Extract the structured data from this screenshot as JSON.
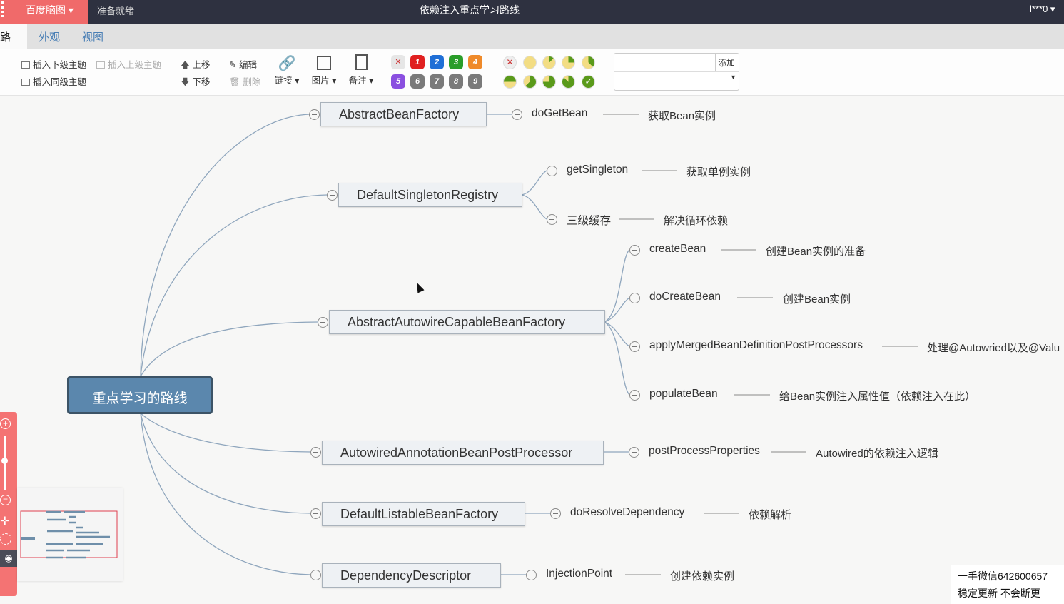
{
  "titlebar": {
    "brand": "百度脑图",
    "status": "准备就绪",
    "title": "依赖注入重点学习路线",
    "user": "l***0"
  },
  "tabs": [
    {
      "label": "思路"
    },
    {
      "label": "外观"
    },
    {
      "label": "视图"
    }
  ],
  "toolbar": {
    "insert_child": "插入下级主题",
    "insert_parent": "插入上级主题",
    "insert_sibling": "插入同级主题",
    "move_up": "上移",
    "move_down": "下移",
    "edit": "编辑",
    "delete": "删除",
    "link": "链接",
    "image": "图片",
    "note": "备注",
    "add": "添加",
    "priorities": [
      "1",
      "2",
      "3",
      "4",
      "5",
      "6",
      "7",
      "8",
      "9"
    ],
    "priority_colors": [
      "#e02020",
      "#1f6fd6",
      "#2a9d2a",
      "#ef8a2a",
      "#8a4fe0",
      "#7a7a7a",
      "#7a7a7a",
      "#7a7a7a",
      "#7a7a7a"
    ]
  },
  "mindmap": {
    "root": "重点学习的路线",
    "l1": [
      "AbstractBeanFactory",
      "DefaultSingletonRegistry",
      "AbstractAutowireCapableBeanFactory",
      "AutowiredAnnotationBeanPostProcessor",
      "DefaultListableBeanFactory",
      "DependencyDescriptor"
    ],
    "l2": [
      "doGetBean",
      "getSingleton",
      "三级缓存",
      "createBean",
      "doCreateBean",
      "applyMergedBeanDefinitionPostProcessors",
      "populateBean",
      "postProcessProperties",
      "doResolveDependency",
      "InjectionPoint"
    ],
    "l3": [
      "获取Bean实例",
      "获取单例实例",
      "解决循环依赖",
      "创建Bean实例的准备",
      "创建Bean实例",
      "处理@Autowried以及@Valu",
      "给Bean实例注入属性值（依赖注入在此）",
      "Autowired的依赖注入逻辑",
      "依赖解析",
      "创建依赖实例"
    ]
  },
  "watermark": {
    "line1": "一手微信642600657",
    "line2": "稳定更新 不会断更"
  }
}
